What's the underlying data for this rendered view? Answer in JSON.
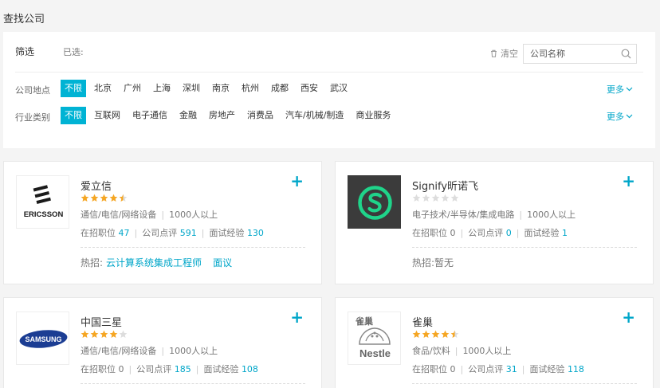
{
  "page": {
    "title": "查找公司"
  },
  "filter": {
    "label": "筛选",
    "selected_label": "已选:",
    "clear_label": "清空",
    "search_placeholder": "公司名称",
    "more_label": "更多",
    "rows": [
      {
        "label": "公司地点",
        "options": [
          "不限",
          "北京",
          "广州",
          "上海",
          "深圳",
          "南京",
          "杭州",
          "成都",
          "西安",
          "武汉"
        ],
        "active": 0
      },
      {
        "label": "行业类别",
        "options": [
          "不限",
          "互联网",
          "电子通信",
          "金融",
          "房地产",
          "消费品",
          "汽车/机械/制造",
          "商业服务"
        ],
        "active": 0
      }
    ]
  },
  "companies": [
    {
      "name": "爱立信",
      "logo": "ericsson-logo",
      "logo_text": "ERICSSON",
      "rating": 4.5,
      "industry": "通信/电信/网络设备",
      "size": "1000人以上",
      "jobs_label": "在招职位",
      "jobs": "47",
      "reviews_label": "公司点评",
      "reviews": "591",
      "interviews_label": "面试经验",
      "interviews": "130",
      "hot_label": "热招:",
      "hot_job": "云计算系统集成工程师",
      "hot_salary": "面议"
    },
    {
      "name": "Signify昕诺飞",
      "logo": "signify-logo",
      "rating": 0,
      "industry": "电子技术/半导体/集成电路",
      "size": "1000人以上",
      "jobs_label": "在招职位",
      "jobs": "0",
      "reviews_label": "公司点评",
      "reviews": "0",
      "interviews_label": "面试经验",
      "interviews": "1",
      "hot_label": "热招:",
      "hot_job": "暂无",
      "hot_salary": ""
    },
    {
      "name": "中国三星",
      "logo": "samsung-logo",
      "logo_text": "SAMSUNG",
      "rating": 4,
      "industry": "通信/电信/网络设备",
      "size": "1000人以上",
      "jobs_label": "在招职位",
      "jobs": "0",
      "reviews_label": "公司点评",
      "reviews": "185",
      "interviews_label": "面试经验",
      "interviews": "108"
    },
    {
      "name": "雀巢",
      "logo": "nestle-logo",
      "logo_text": "Nestle",
      "logo_text_cn": "雀巢",
      "rating": 4.5,
      "industry": "食品/饮料",
      "size": "1000人以上",
      "jobs_label": "在招职位",
      "jobs": "0",
      "reviews_label": "公司点评",
      "reviews": "31",
      "interviews_label": "面试经验",
      "interviews": "118"
    }
  ],
  "colors": {
    "accent": "#00b3d4",
    "link": "#00a6c9",
    "star": "#f5a623",
    "star_empty": "#dddddd"
  }
}
